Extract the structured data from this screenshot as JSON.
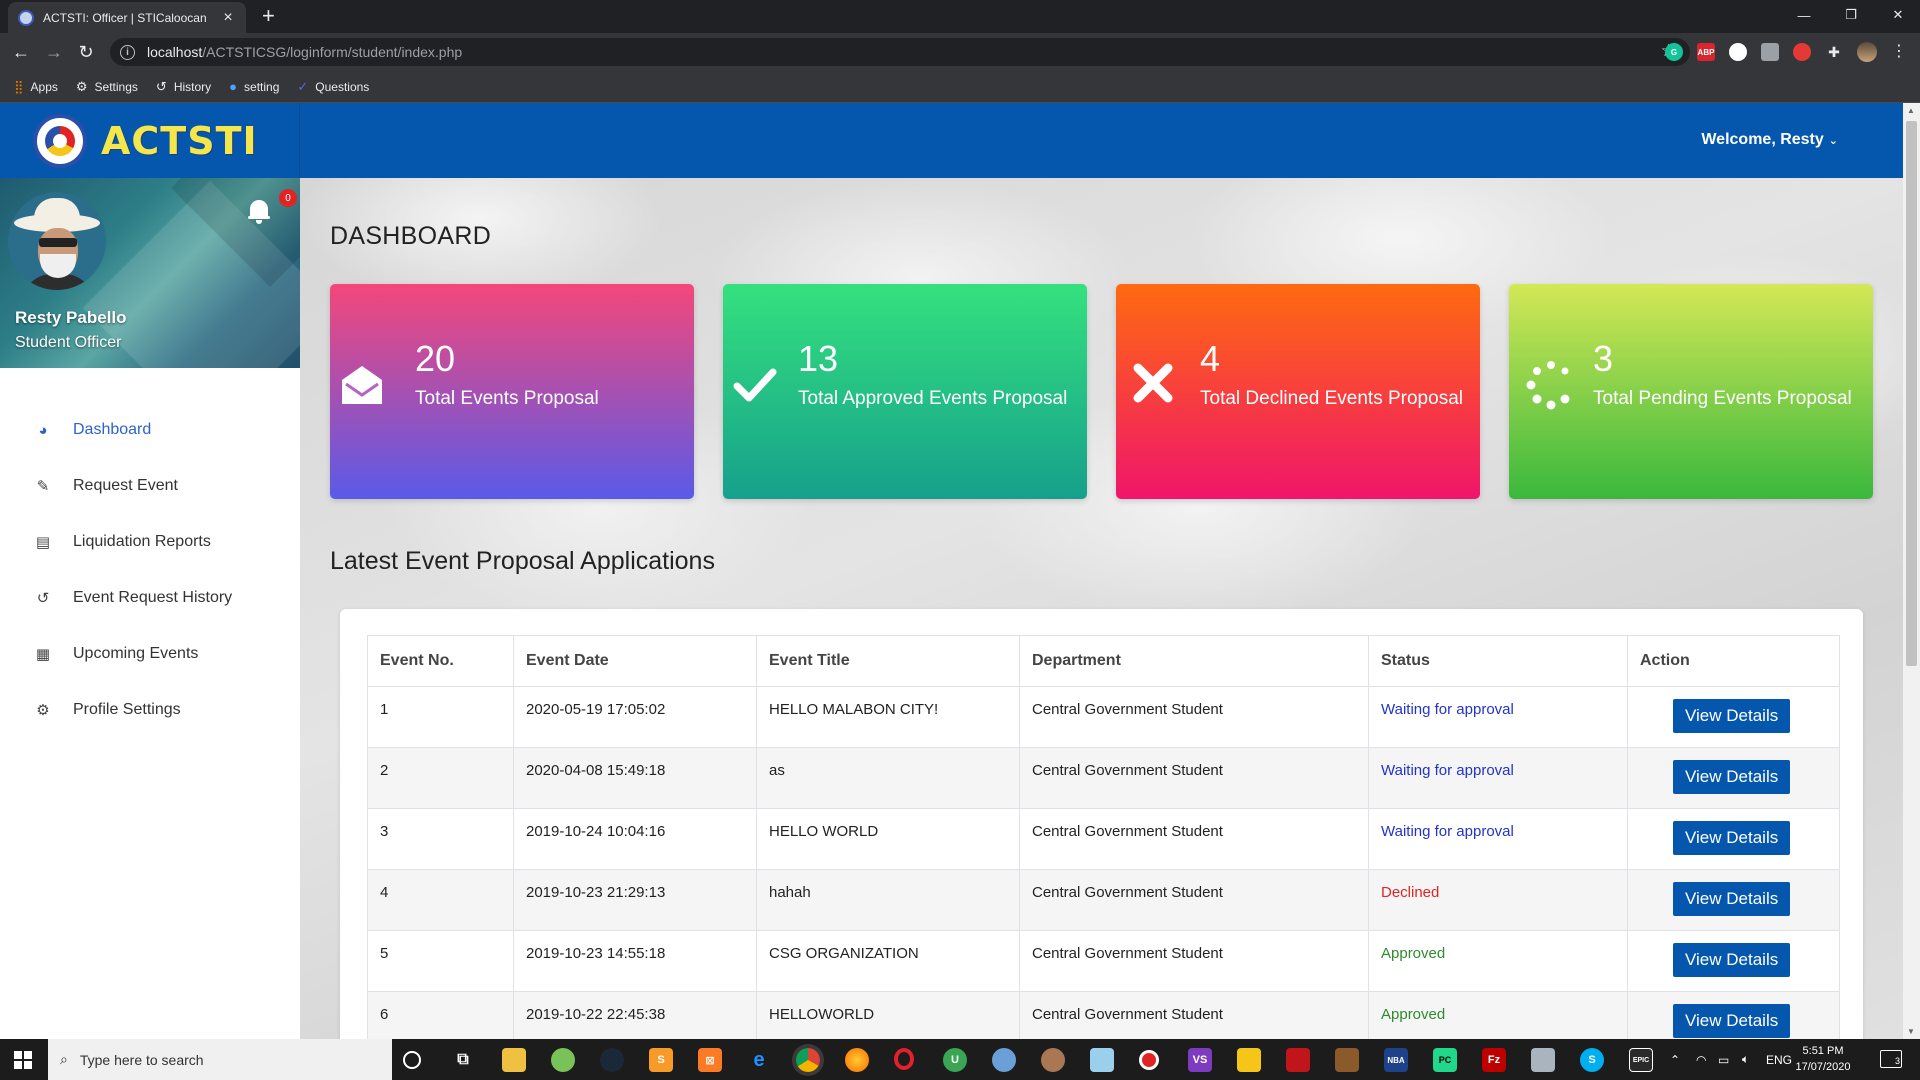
{
  "browser": {
    "tab_title": "ACTSTI: Officer | STICaloocan",
    "url_host": "localhost",
    "url_path": "/ACTSTICSG/loginform/student/index.php",
    "bookmarks": [
      {
        "label": "Apps",
        "icon": "apps-grid-icon"
      },
      {
        "label": "Settings",
        "icon": "gear-icon"
      },
      {
        "label": "History",
        "icon": "history-icon"
      },
      {
        "label": "setting",
        "icon": "drop-icon"
      },
      {
        "label": "Questions",
        "icon": "check-icon"
      }
    ],
    "extensions": [
      "grammarly-icon",
      "adblock-plus-icon",
      "extension-icon",
      "extension-icon",
      "extension-icon",
      "puzzle-icon",
      "profile-avatar-icon"
    ]
  },
  "header": {
    "brand": "ACTSTI",
    "welcome": "Welcome, Resty"
  },
  "profile": {
    "name": "Resty Pabello",
    "role": "Student Officer",
    "notifications": "0"
  },
  "menu": [
    {
      "label": "Dashboard",
      "icon": "dashboard-icon",
      "active": true
    },
    {
      "label": "Request Event",
      "icon": "pencil-icon"
    },
    {
      "label": "Liquidation Reports",
      "icon": "clipboard-icon"
    },
    {
      "label": "Event Request History",
      "icon": "history-icon"
    },
    {
      "label": "Upcoming Events",
      "icon": "calendar-icon"
    },
    {
      "label": "Profile Settings",
      "icon": "gear-icon"
    }
  ],
  "dashboard": {
    "title": "DASHBOARD",
    "cards": [
      {
        "value": "20",
        "label": "Total Events Proposal",
        "icon": "envelope-open-icon"
      },
      {
        "value": "13",
        "label": "Total Approved Events Proposal",
        "icon": "check-icon"
      },
      {
        "value": "4",
        "label": "Total Declined Events Proposal",
        "icon": "x-icon"
      },
      {
        "value": "3",
        "label": "Total Pending Events Proposal",
        "icon": "spinner-icon"
      }
    ]
  },
  "latest": {
    "title": "Latest Event Proposal Applications",
    "columns": [
      "Event No.",
      "Event Date",
      "Event Title",
      "Department",
      "Status",
      "Action"
    ],
    "rows": [
      {
        "no": "1",
        "date": "2020-05-19 17:05:02",
        "title": "HELLO MALABON CITY!",
        "dept": "Central Government Student",
        "status": "Waiting for approval",
        "status_type": "wait",
        "action": "View Details"
      },
      {
        "no": "2",
        "date": "2020-04-08 15:49:18",
        "title": "as",
        "dept": "Central Government Student",
        "status": "Waiting for approval",
        "status_type": "wait",
        "action": "View Details"
      },
      {
        "no": "3",
        "date": "2019-10-24 10:04:16",
        "title": "HELLO WORLD",
        "dept": "Central Government Student",
        "status": "Waiting for approval",
        "status_type": "wait",
        "action": "View Details"
      },
      {
        "no": "4",
        "date": "2019-10-23 21:29:13",
        "title": "hahah",
        "dept": "Central Government Student",
        "status": "Declined",
        "status_type": "dec",
        "action": "View Details"
      },
      {
        "no": "5",
        "date": "2019-10-23 14:55:18",
        "title": "CSG ORGANIZATION",
        "dept": "Central Government Student",
        "status": "Approved",
        "status_type": "app",
        "action": "View Details"
      },
      {
        "no": "6",
        "date": "2019-10-22 22:45:38",
        "title": "HELLOWORLD",
        "dept": "Central Government Student",
        "status": "Approved",
        "status_type": "app",
        "action": "View Details"
      }
    ]
  },
  "taskbar": {
    "search_placeholder": "Type here to search",
    "language": "ENG",
    "time": "5:51 PM",
    "date": "17/07/2020",
    "notification_count": "3"
  },
  "colors": {
    "brand_blue": "#0457ad",
    "brand_yellow": "#f5e64b",
    "waiting": "#2233cc",
    "declined": "#e02424",
    "approved": "#2e8b2e"
  }
}
